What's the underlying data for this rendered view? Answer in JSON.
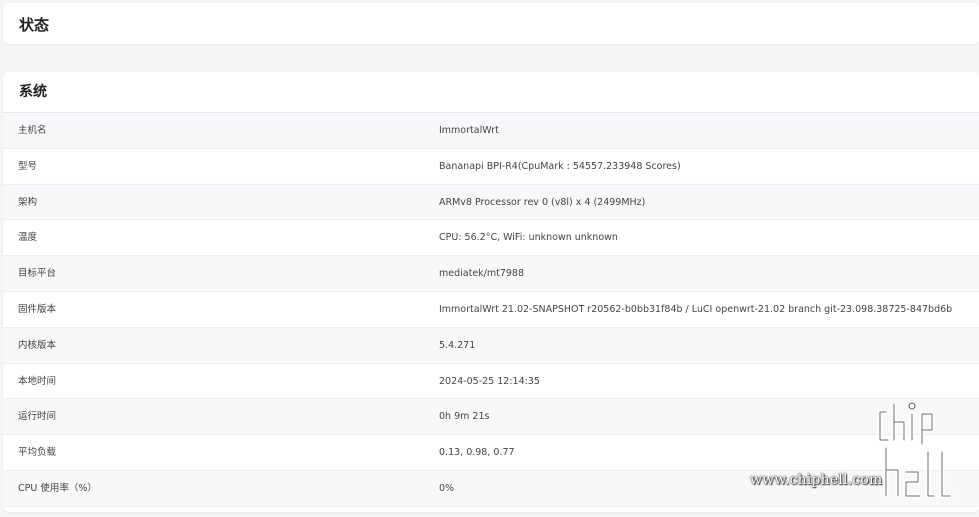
{
  "header": {
    "title": "状态"
  },
  "system": {
    "title": "系统",
    "rows": [
      {
        "label": "主机名",
        "value": "ImmortalWrt"
      },
      {
        "label": "型号",
        "value": "Bananapi BPI-R4(CpuMark : 54557.233948 Scores)"
      },
      {
        "label": "架构",
        "value": "ARMv8 Processor rev 0 (v8l) x 4 (2499MHz)"
      },
      {
        "label": "温度",
        "value": "CPU: 56.2°C, WiFi: unknown unknown"
      },
      {
        "label": "目标平台",
        "value": "mediatek/mt7988"
      },
      {
        "label": "固件版本",
        "value": "ImmortalWrt 21.02-SNAPSHOT r20562-b0bb31f84b / LuCI openwrt-21.02 branch git-23.098.38725-847bd6b"
      },
      {
        "label": "内核版本",
        "value": "5.4.271"
      },
      {
        "label": "本地时间",
        "value": "2024-05-25 12:14:35"
      },
      {
        "label": "运行时间",
        "value": "0h 9m 21s"
      },
      {
        "label": "平均负载",
        "value": "0.13, 0.98, 0.77"
      },
      {
        "label": "CPU 使用率（%）",
        "value": "0%"
      }
    ]
  },
  "watermark": {
    "url": "www.chiphell.com"
  }
}
